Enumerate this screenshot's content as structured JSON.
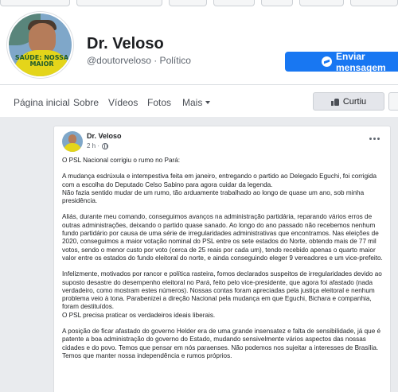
{
  "profile": {
    "name": "Dr. Veloso",
    "subtitle": "@doutorveloso · Político",
    "shirt_text": "SAÚDE: NOSSA MAIOR"
  },
  "actions": {
    "message_label": "Enviar mensagem",
    "message_icon": "messenger-icon",
    "liked_label": "Curtiu",
    "liked_icon": "thumbs-up-icon"
  },
  "nav": {
    "items": [
      "Página inicial",
      "Sobre",
      "Vídeos",
      "Fotos",
      "Mais"
    ]
  },
  "post": {
    "author": "Dr. Veloso",
    "time": "2 h ·",
    "paragraphs": [
      "O PSL Nacional corrigiu o rumo no Pará:",
      "A mudança esdrúxula e intempestiva feita em janeiro, entregando o partido ao Delegado Eguchi, foi corrigida com a escolha do Deputado Celso Sabino para agora cuidar da legenda.",
      "Não fazia sentido mudar de um rumo, tão arduamente trabalhado ao longo de quase um ano, sob minha presidência.",
      "Aliás, durante meu comando, conseguimos avanços na administração partidária, reparando vários erros de outras administrações, deixando o partido quase sanado. Ao longo do ano passado não recebemos nenhum fundo partidário por causa de uma série de irregularidades administrativas que encontramos. Nas eleições de 2020, conseguimos a maior votação nominal do PSL entre os sete estados do Norte, obtendo mais de 77 mil votos, sendo o menor custo por voto (cerca de 25 reais por cada um), tendo recebido apenas o quarto maior valor entre os estados do fundo eleitoral do norte, e ainda conseguindo eleger 9 vereadores e um vice-prefeito.",
      "Infelizmente, motivados por rancor e política rasteira, fomos declarados suspeitos de irregularidades devido ao suposto desastre do desempenho eleitoral no Pará, feito pelo vice-presidente, que agora foi afastado (nada verdadeiro, como mostram estes números). Nossas contas foram apreciadas pela justiça eleitoral e nenhum problema veio à tona. Parabenizei a direção Nacional pela mudança em que Eguchi, Bichara e companhia, foram destituídos.",
      "O PSL precisa praticar os verdadeiros ideais liberais.",
      "A posição de ficar afastado do governo Helder era de uma grande insensatez e falta de sensibilidade, já que é patente a boa administração do governo do Estado, mudando sensivelmente vários aspectos das nossas cidades e do povo. Temos que pensar em nós paraenses. Não podemos nos sujeitar a interesses de Brasília. Temos que manter nossa independência e rumos próprios."
    ]
  },
  "colors": {
    "accent": "#1877f2",
    "background": "#e9ebee"
  }
}
